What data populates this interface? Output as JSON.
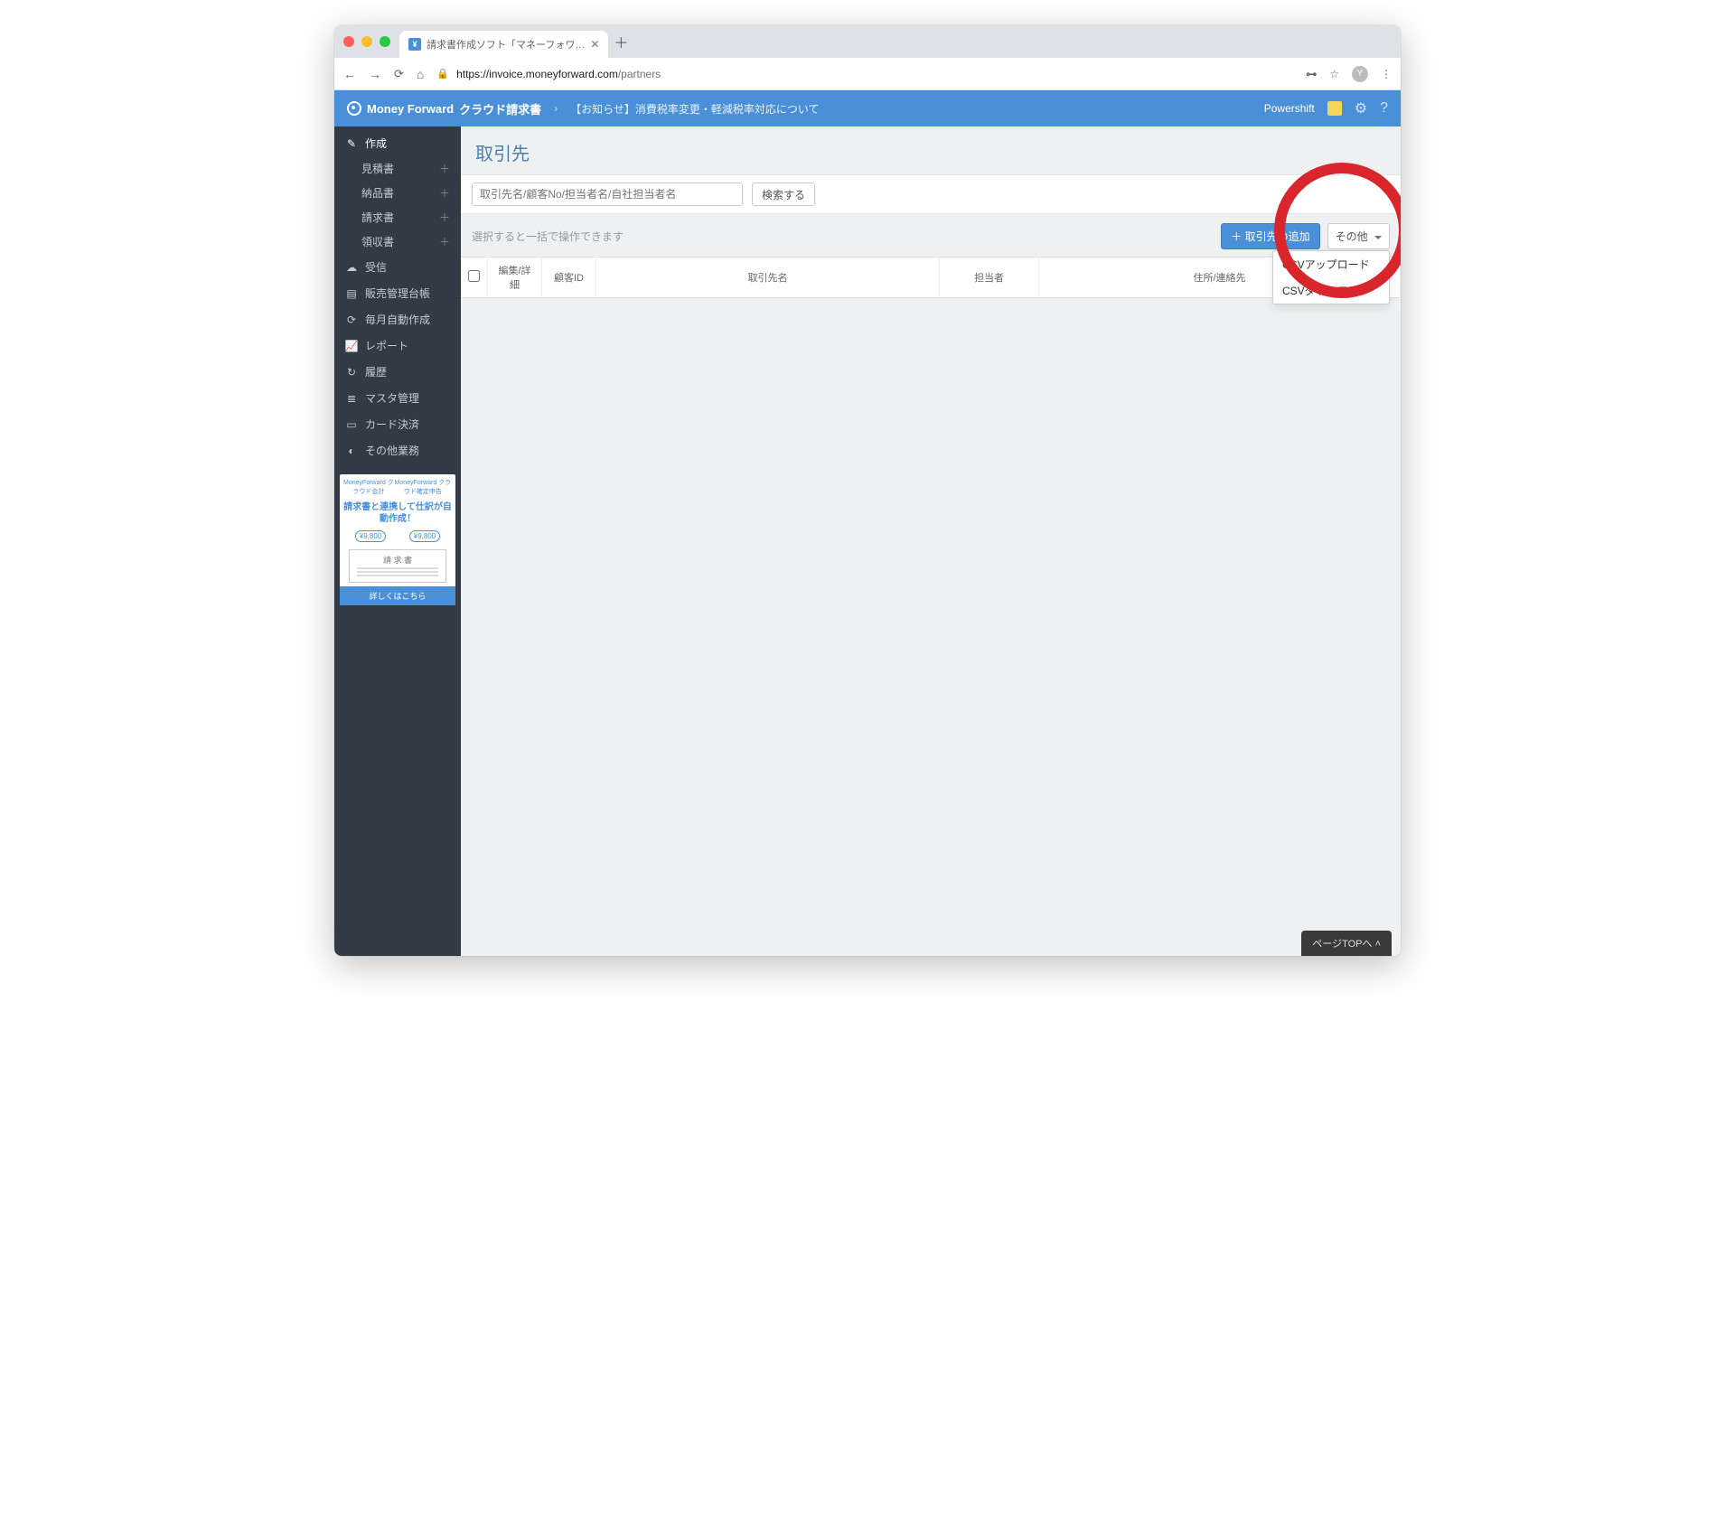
{
  "browser": {
    "tab_title": "請求書作成ソフト「マネーフォワ…",
    "url_host": "https://invoice.moneyforward.com",
    "url_path": "/partners",
    "avatar_letter": "Y",
    "key_icon": "⌼",
    "star_icon": "☆",
    "menu_icon": "⋮"
  },
  "header": {
    "brand": "Money Forward",
    "brand_suffix": "クラウド請求書",
    "notice": "【お知らせ】消費税率変更・軽減税率対応について",
    "user": "Powershift"
  },
  "sidebar": {
    "create": "作成",
    "subs": [
      {
        "label": "見積書"
      },
      {
        "label": "納品書"
      },
      {
        "label": "請求書"
      },
      {
        "label": "領収書"
      }
    ],
    "items": [
      {
        "label": "受信"
      },
      {
        "label": "販売管理台帳"
      },
      {
        "label": "毎月自動作成"
      },
      {
        "label": "レポート"
      },
      {
        "label": "履歴"
      },
      {
        "label": "マスタ管理"
      },
      {
        "label": "カード決済"
      },
      {
        "label": "その他業務"
      }
    ],
    "promo": {
      "top_left": "MoneyForward クラウド会計",
      "top_right": "MoneyForward クラウド確定申告",
      "title": "請求書と連携して仕訳が自動作成！",
      "price1": "¥9,800",
      "price2": "¥9,800",
      "doc_label": "請 求 書",
      "cta": "詳しくはこちら"
    }
  },
  "main": {
    "title": "取引先",
    "search_placeholder": "取引先名/顧客No/担当者名/自社担当者名",
    "search_btn": "検索する",
    "hint": "選択すると一括で操作できます",
    "add_btn": "取引先の追加",
    "other_btn": "その他",
    "dropdown": {
      "upload": "CSVアップロード",
      "download": "CSVダウンロード"
    },
    "columns": {
      "edit": "編集/詳細",
      "cust": "顧客ID",
      "name": "取引先名",
      "person": "担当者",
      "addr": "住所/連絡先"
    },
    "page_top": "ページTOPへ"
  }
}
